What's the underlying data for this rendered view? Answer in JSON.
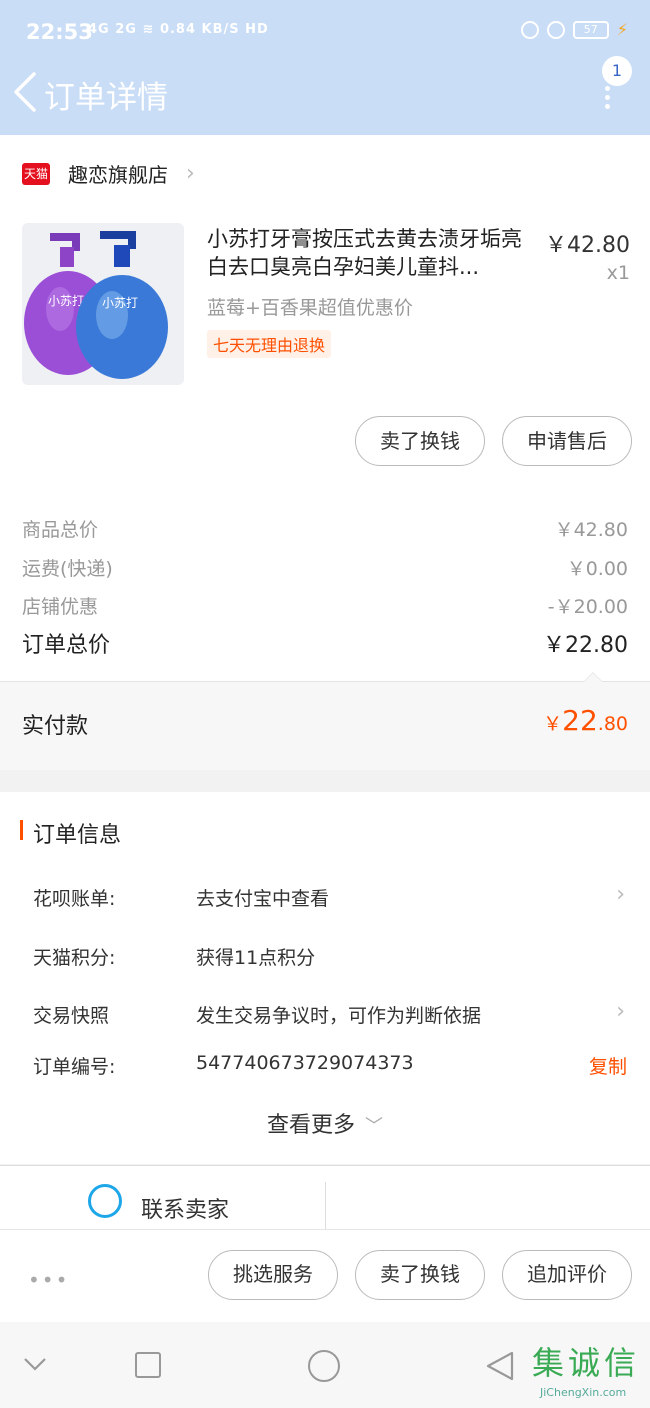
{
  "status_bar": {
    "time": "22:53",
    "network": "4G 2G",
    "speed": "0.84 KB/S",
    "hd": "HD",
    "battery": "57"
  },
  "nav": {
    "title": "订单详情",
    "notification_count": "1"
  },
  "shop": {
    "logo_text": "天猫",
    "name": "趣恋旗舰店"
  },
  "product": {
    "title": "小苏打牙膏按压式去黄去渍牙垢亮白去口臭亮白孕妇美儿童抖...",
    "price": "￥42.80",
    "quantity": "x1",
    "sku": "蓝莓+百香果超值优惠价",
    "tag": "七天无理由退换",
    "bottle_left_text": "小苏打",
    "bottle_right_text": "小苏打"
  },
  "product_actions": {
    "sell_label": "卖了换钱",
    "after_sale_label": "申请售后"
  },
  "fees": [
    {
      "label": "商品总价",
      "value": "￥42.80"
    },
    {
      "label": "运费(快递)",
      "value": "￥0.00"
    },
    {
      "label": "店铺优惠",
      "value": "-￥20.00"
    }
  ],
  "order_total": {
    "label": "订单总价",
    "value": "￥22.80"
  },
  "payment": {
    "label": "实付款",
    "currency": "￥",
    "integer": "22",
    "decimal": ".80"
  },
  "order_info": {
    "title": "订单信息",
    "rows": [
      {
        "key": "花呗账单:",
        "value": "去支付宝中查看"
      },
      {
        "key": "天猫积分:",
        "value": "获得11点积分"
      },
      {
        "key": "交易快照",
        "value": "发生交易争议时，可作为判断依据"
      },
      {
        "key": "订单编号:",
        "value": "547740673729074373"
      }
    ],
    "copy_label": "复制",
    "see_more": "查看更多"
  },
  "contact": {
    "label": "联系卖家"
  },
  "action_bar": {
    "more": "•••",
    "pick_service": "挑选服务",
    "sell": "卖了换钱",
    "add_review": "追加评价"
  },
  "watermark": {
    "text": "集诚信",
    "url": "JiChengXin.com"
  },
  "colors": {
    "header_bg": "#c9ddf6",
    "accent": "#ff5000",
    "tmall_red": "#e4101e",
    "contact_blue": "#1ea7e8"
  }
}
